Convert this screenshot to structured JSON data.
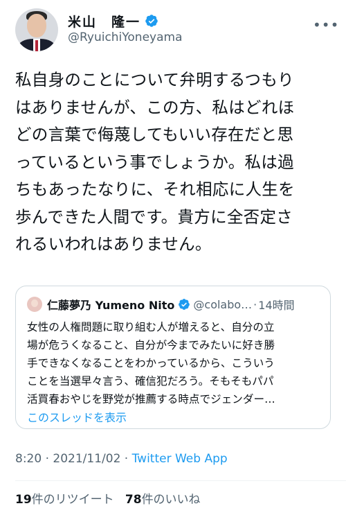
{
  "author": {
    "display_name": "米山　隆一",
    "handle": "@RyuichiYoneyama",
    "verified": true
  },
  "tweet": {
    "text": "私自身のことについて弁明するつもり\nはありませんが、この方、私はどれほ\nどの言葉で侮蔑してもいい存在だと思\nっているという事でしょうか。私は過\nちもあったなりに、それ相応に人生を\n歩んできた人間です。貴方に全否定さ\nれるいわれはありません。"
  },
  "quote": {
    "display_name": "仁藤夢乃  Yumeno Nito",
    "handle": "@colabo…",
    "separator": "·",
    "time": "14時間",
    "text": "女性の人権問題に取り組む人が増えると、自分の立\n場が危うくなること、自分が今までみたいに好き勝\n手できなくなることをわかっているから、こういう\nことを当選早々言う、確信犯だろう。そもそもパパ\n活買春おやじを野党が推薦する時点でジェンダー…",
    "show_thread": "このスレッドを表示"
  },
  "meta": {
    "time": "8:20",
    "separator": "·",
    "date": "2021/11/02",
    "client": "Twitter Web App"
  },
  "stats": {
    "retweets": "19",
    "retweets_label": "件のリツイート",
    "likes": "78",
    "likes_label": "件のいいね"
  },
  "colors": {
    "accent": "#1d9bf0",
    "text": "#0f1419",
    "secondary": "#536471",
    "border": "#cfd9de"
  },
  "icons": [
    "verified-badge-icon",
    "more-options-icon"
  ]
}
